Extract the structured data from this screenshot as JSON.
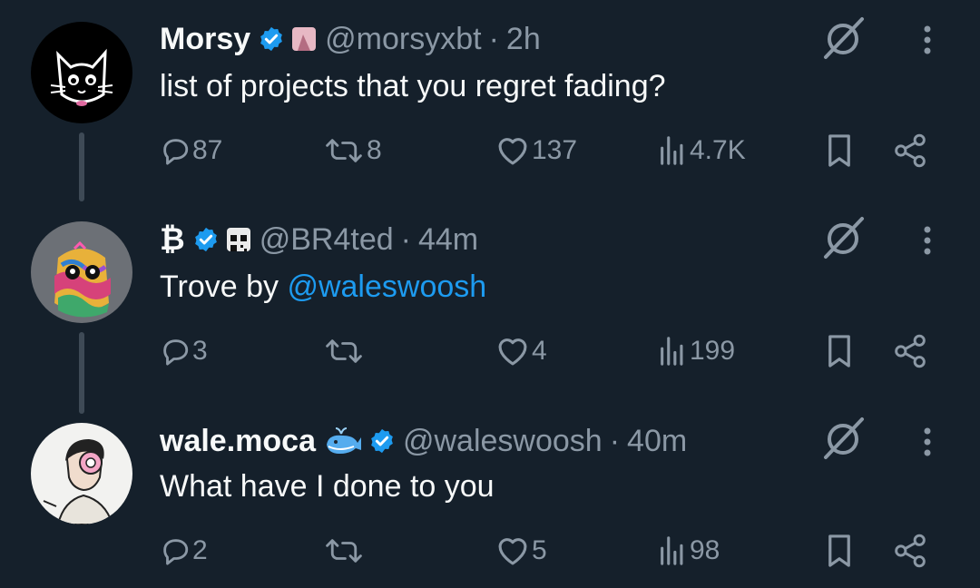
{
  "theme": {
    "background": "#15202b",
    "secondary_text": "#8b98a5",
    "accent": "#1d9bf0",
    "verified": "#1d9bf0",
    "line": "#3e4a56"
  },
  "tweets": [
    {
      "name": "Morsy",
      "handle": "@morsyxbt",
      "separator": "·",
      "time": "2h",
      "text": "list of projects that you regret fading?",
      "replies": "87",
      "reposts": "8",
      "likes": "137",
      "views": "4.7K"
    },
    {
      "name": "₿",
      "handle": "@BR4ted",
      "separator": "·",
      "time": "44m",
      "text_prefix": "Trove by ",
      "mention": "@waleswoosh",
      "replies": "3",
      "reposts": "",
      "likes": "4",
      "views": "199"
    },
    {
      "name": "wale.moca",
      "handle": "@waleswoosh",
      "separator": "·",
      "time": "40m",
      "text": "What have I done to you",
      "replies": "2",
      "reposts": "",
      "likes": "5",
      "views": "98"
    }
  ],
  "icons": {
    "reply": "reply-icon",
    "repost": "repost-icon",
    "like": "heart-icon",
    "views": "views-icon",
    "bookmark": "bookmark-icon",
    "share": "share-icon",
    "grok": "grok-icon",
    "more": "more-icon",
    "verified": "verified-badge-icon"
  }
}
